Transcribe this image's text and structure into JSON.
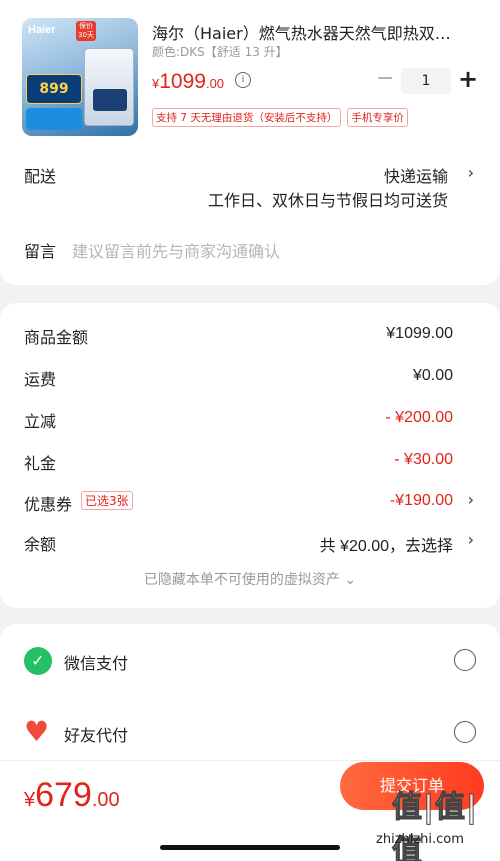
{
  "product": {
    "image_brand": "Haier",
    "image_badge": "保价30天",
    "image_capacity": "13",
    "image_price_badge": "899",
    "title": "海尔（Haier）燃气热水器天然气即热双…",
    "spec": "颜色:DKS【舒适 13 升】",
    "price_currency": "¥",
    "price_int": "1099",
    "price_dec": ".00",
    "info_icon": "ⓘ",
    "qty_minus": "−",
    "quantity": "1",
    "qty_plus": "+",
    "tags": [
      "支持 7 天无理由退货（安装后不支持）",
      "手机专享价"
    ]
  },
  "shipping": {
    "label": "配送",
    "value": "快递运输",
    "sub": "工作日、双休日与节假日均可送货",
    "chevron": "›"
  },
  "message": {
    "label": "留言",
    "placeholder": "建议留言前先与商家沟通确认"
  },
  "amounts": {
    "goods_label": "商品金额",
    "goods_value": "¥1099.00",
    "freight_label": "运费",
    "freight_value": "¥0.00",
    "discount_label": "立减",
    "discount_value": "- ¥200.00",
    "gift_label": "礼金",
    "gift_value": "- ¥30.00",
    "coupon_label": "优惠券",
    "coupon_tag": "已选3张",
    "coupon_value": "-¥190.00",
    "balance_label": "余额",
    "balance_value": "共 ¥20.00，去选择",
    "chevron": "›",
    "hidden_note": "已隐藏本单不可使用的虚拟资产 ⌄"
  },
  "payment": {
    "wechat_label": "微信支付",
    "wechat_icon_glyph": "✓",
    "friend_label": "好友代付",
    "friend_icon_glyph": "♥"
  },
  "footer": {
    "total_currency": "¥",
    "total_int": "679",
    "total_dec": ".00",
    "submit_label": "提交订单",
    "watermark": "值|值|值",
    "watermark_site": "zhizhizhi.com"
  },
  "colors": {
    "accent_red": "#e2231a",
    "wechat_green": "#23c161"
  }
}
